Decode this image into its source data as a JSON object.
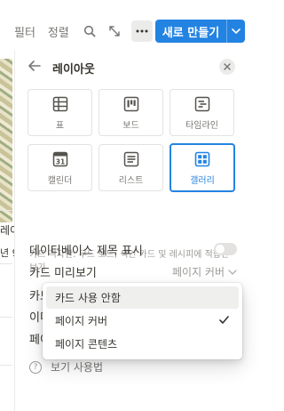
{
  "toolbar": {
    "filter_label": "필터",
    "sort_label": "정렬",
    "search_icon": "search-icon",
    "expand_icon": "expand-icon",
    "more_icon": "more-icon",
    "new_button_label": "새로 만들기",
    "accent_color": "#2383e2"
  },
  "background": {
    "text1": "레이",
    "text2": "년 9"
  },
  "panel": {
    "title": "레이아웃",
    "layouts": [
      {
        "label": "표",
        "icon": "table-icon"
      },
      {
        "label": "보드",
        "icon": "board-icon"
      },
      {
        "label": "타임라인",
        "icon": "timeline-icon"
      },
      {
        "label": "캘린더",
        "icon": "calendar-icon",
        "calendar_day": "31"
      },
      {
        "label": "리스트",
        "icon": "list-icon"
      },
      {
        "label": "갤러리",
        "icon": "gallery-icon",
        "selected": true
      }
    ],
    "description": "카드 격자판: 무드 보드, 색인 카드 및 레시피에 적합한 보기",
    "rows": {
      "show_db_title": {
        "label": "데이터베이스 제목 표시",
        "toggle": false
      },
      "card_preview": {
        "label": "카드 미리보기",
        "value": "페이지 커버"
      },
      "hidden1": {
        "label": "카드"
      },
      "hidden2": {
        "label": "이미"
      },
      "hidden3": {
        "label": "페이"
      }
    },
    "help_label": "보기 사용법"
  },
  "menu": {
    "items": [
      {
        "label": "카드 사용 안함",
        "hover": true
      },
      {
        "label": "페이지 커버",
        "checked": true
      },
      {
        "label": "페이지 콘텐츠"
      }
    ]
  }
}
